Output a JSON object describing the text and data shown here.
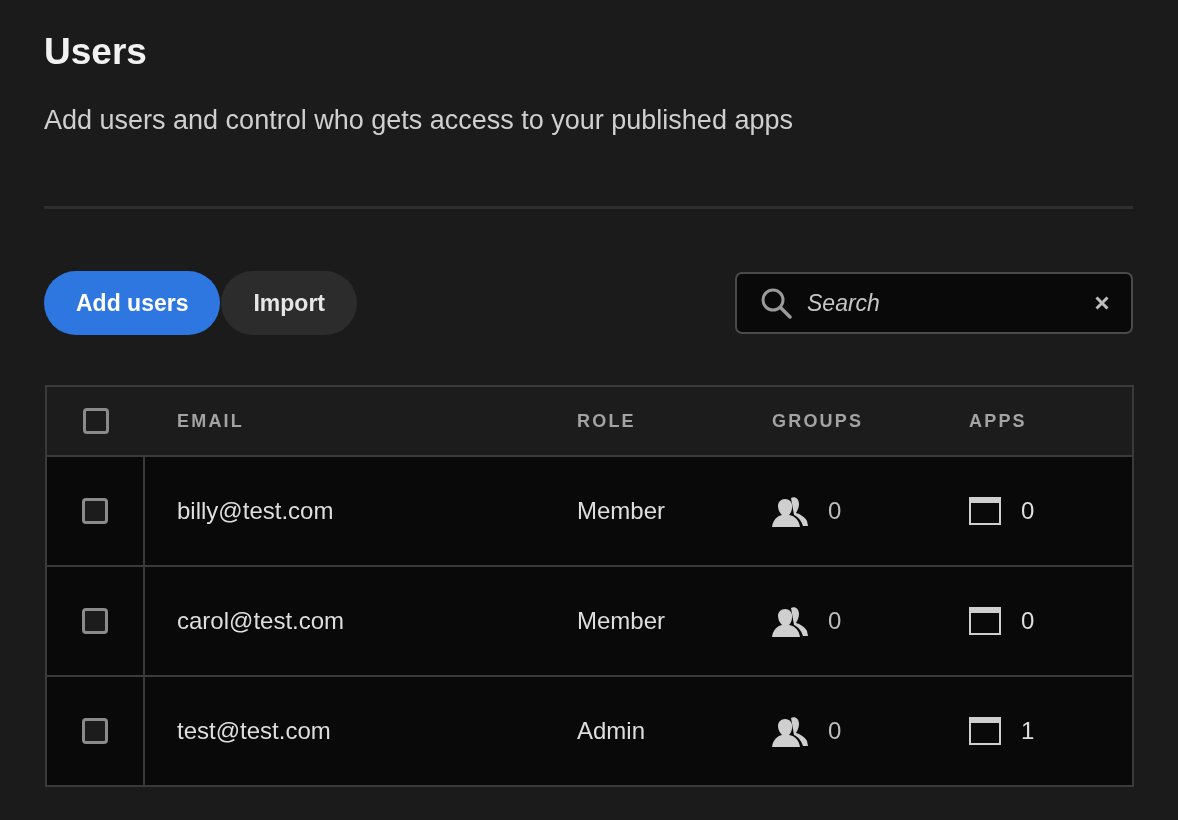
{
  "page": {
    "title": "Users",
    "subtitle": "Add users and control who gets access to your published apps"
  },
  "toolbar": {
    "buttons": [
      {
        "label": "Add users",
        "kind": "primary"
      },
      {
        "label": "Import",
        "kind": "secondary"
      }
    ],
    "search": {
      "placeholder": "Search"
    }
  },
  "table": {
    "select_all": {
      "checked": false
    },
    "columns": [
      "EMAIL",
      "ROLE",
      "GROUPS",
      "APPS"
    ],
    "rows": [
      {
        "checked": false,
        "email": "billy@test.com",
        "role": "Member",
        "groups": "0",
        "apps": "0"
      },
      {
        "checked": false,
        "email": "carol@test.com",
        "role": "Member",
        "groups": "0",
        "apps": "0"
      },
      {
        "checked": false,
        "email": "test@test.com",
        "role": "Admin",
        "groups": "0",
        "apps": "1"
      }
    ]
  }
}
